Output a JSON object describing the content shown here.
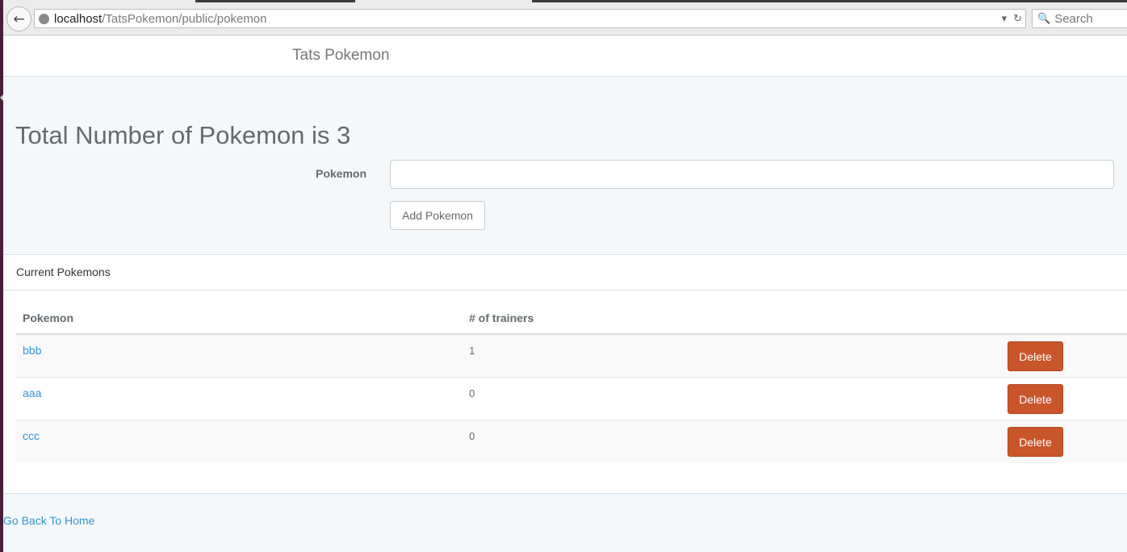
{
  "browser": {
    "url_host": "localhost",
    "url_path": "/TatsPokemon/public/pokemon",
    "search_placeholder": "Search",
    "dropdown_glyph": "▾",
    "reload_glyph": "↻",
    "back_glyph": "←",
    "search_glyph": "🔍"
  },
  "navbar": {
    "brand": "Tats Pokemon"
  },
  "main": {
    "title": "Total Number of Pokemon is 3",
    "form": {
      "label": "Pokemon",
      "input_value": "",
      "submit_label": "Add Pokemon"
    }
  },
  "panel": {
    "heading": "Current Pokemons",
    "table": {
      "columns": [
        "Pokemon",
        "# of trainers"
      ],
      "rows": [
        {
          "name": "bbb",
          "trainers": "1",
          "action": "Delete"
        },
        {
          "name": "aaa",
          "trainers": "0",
          "action": "Delete"
        },
        {
          "name": "ccc",
          "trainers": "0",
          "action": "Delete"
        }
      ]
    }
  },
  "footer": {
    "back_link": "Go Back To Home"
  },
  "colors": {
    "accent_link": "#3097d1",
    "delete_button": "#c9552b",
    "page_background": "#f5f8fa"
  }
}
